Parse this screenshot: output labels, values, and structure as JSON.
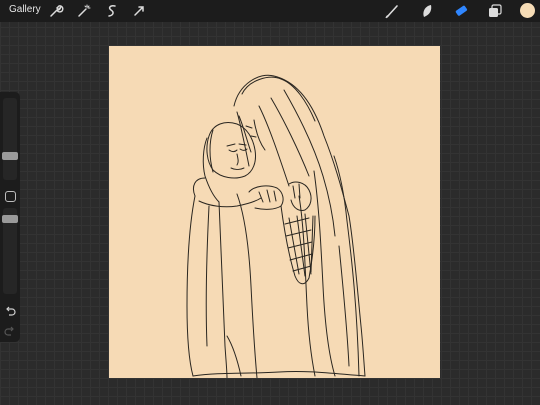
{
  "topbar": {
    "gallery_label": "Gallery",
    "left_tools": [
      "wrench-icon",
      "magic-wand-icon",
      "selection-icon",
      "transform-icon"
    ],
    "right_tools": [
      "brush-icon",
      "smudge-icon",
      "eraser-icon",
      "layers-icon"
    ],
    "active_tool": "eraser",
    "active_color": "#f6dcb6"
  },
  "sidebar": {
    "brush_size_level": 0.5,
    "opacity_level": 0.6,
    "controls": [
      "brush-size-slider",
      "modify-button",
      "opacity-slider",
      "undo-icon",
      "redo-icon"
    ]
  },
  "canvas": {
    "background_color": "#f6dab5",
    "stroke_color": "#2a2620",
    "content": "line-art-sketch"
  }
}
